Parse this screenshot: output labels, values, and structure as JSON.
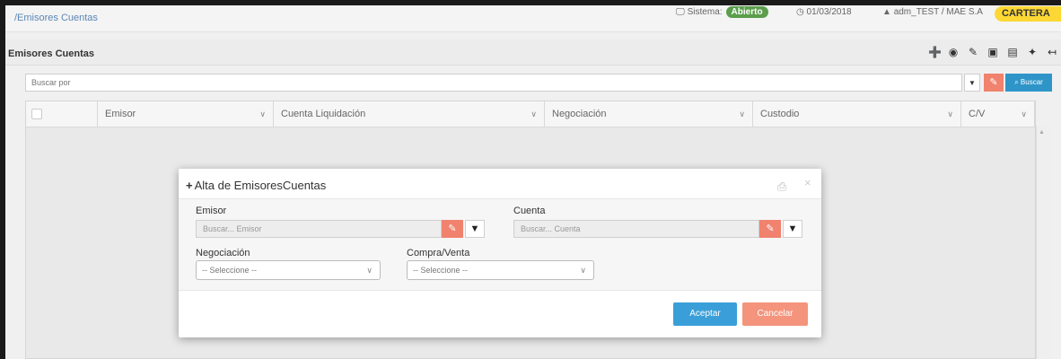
{
  "topbar": {
    "breadcrumb": "/Emisores Cuentas",
    "system_label": "Sistema:",
    "system_status": "Abierto",
    "date": "01/03/2018",
    "user": "adm_TEST / MAE S.A",
    "portfolio": "CARTERA"
  },
  "panel": {
    "title": "Emisores Cuentas",
    "toolbar_icons": [
      "add-icon",
      "view-icon",
      "edit-icon",
      "delete-icon",
      "export-icon",
      "move-icon",
      "expand-icon",
      "close-icon"
    ]
  },
  "search": {
    "placeholder": "Buscar por",
    "search_label": "Buscar"
  },
  "grid": {
    "columns": [
      "Emisor",
      "Cuenta Liquidación",
      "Negociación",
      "Custodio",
      "C/V"
    ]
  },
  "modal": {
    "title": "Alta de EmisoresCuentas",
    "emisor_label": "Emisor",
    "emisor_placeholder": "Buscar... Emisor",
    "cuenta_label": "Cuenta",
    "cuenta_placeholder": "Buscar... Cuenta",
    "negociacion_label": "Negociación",
    "negociacion_value": "-- Seleccione --",
    "compra_venta_label": "Compra/Venta",
    "compra_venta_value": "-- Seleccione --",
    "accept_label": "Aceptar",
    "cancel_label": "Cancelar"
  },
  "colors": {
    "accent_blue": "#3a9fd8",
    "eraser_orange": "#f0826e",
    "status_green": "#5b9e4d",
    "cartera_yellow": "#fdd835"
  }
}
